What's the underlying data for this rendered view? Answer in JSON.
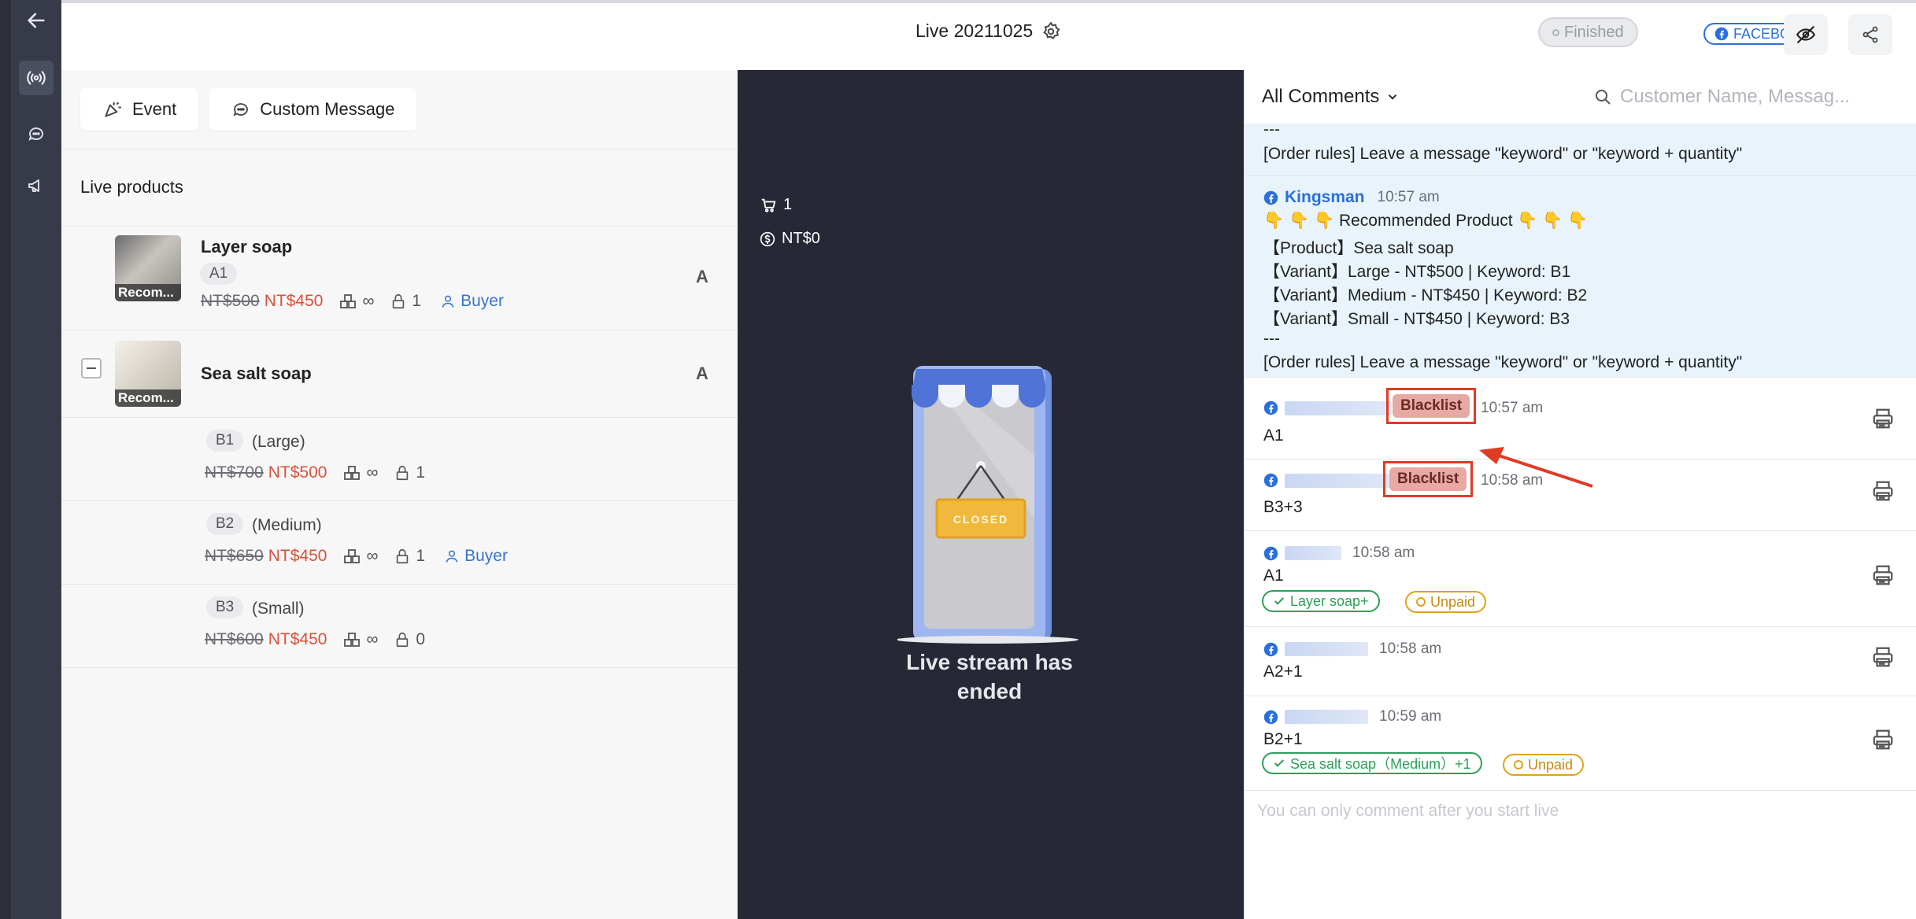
{
  "header": {
    "title": "Live 20211025",
    "status": "Finished",
    "platform": "FACEBOOK"
  },
  "left": {
    "tabs": [
      {
        "label": "Event"
      },
      {
        "label": "Custom Message"
      }
    ],
    "section_title": "Live products",
    "products": [
      {
        "name": "Layer soap",
        "thumb_caption": "Recom...",
        "code": "A1",
        "old_price": "NT$500",
        "new_price": "NT$450",
        "stock": "∞",
        "locked": "1",
        "buyer": "Buyer",
        "group": "A"
      },
      {
        "name": "Sea salt soap",
        "thumb_caption": "Recom...",
        "group": "A",
        "variants": [
          {
            "code": "B1",
            "label": "(Large)",
            "old_price": "NT$700",
            "new_price": "NT$500",
            "stock": "∞",
            "locked": "1",
            "buyer": ""
          },
          {
            "code": "B2",
            "label": "(Medium)",
            "old_price": "NT$650",
            "new_price": "NT$450",
            "stock": "∞",
            "locked": "1",
            "buyer": "Buyer"
          },
          {
            "code": "B3",
            "label": "(Small)",
            "old_price": "NT$600",
            "new_price": "NT$450",
            "stock": "∞",
            "locked": "0",
            "buyer": ""
          }
        ]
      }
    ]
  },
  "video": {
    "cart_count": "1",
    "revenue": "NT$0",
    "sign_text": "CLOSED",
    "ended_text": "Live stream has ended"
  },
  "comments": {
    "filter_label": "All Comments",
    "search_placeholder": "Customer Name, Messag...",
    "top_lines": [
      "---",
      "[Order rules] Leave a message \"keyword\" or \"keyword + quantity\""
    ],
    "host": {
      "name": "Kingsman",
      "time": "10:57 am",
      "lines": [
        "👇 👇 👇 Recommended Product 👇 👇 👇",
        "【Product】Sea salt soap",
        "【Variant】Large - NT$500 | Keyword: B1",
        "【Variant】Medium - NT$450 | Keyword: B2",
        "【Variant】Small - NT$450 | Keyword: B3",
        "---",
        "[Order rules] Leave a message \"keyword\" or \"keyword + quantity\""
      ]
    },
    "items": [
      {
        "badge": "Blacklist",
        "time": "10:57 am",
        "text": "A1"
      },
      {
        "badge": "Blacklist",
        "time": "10:58 am",
        "text": "B3+3"
      },
      {
        "time": "10:58 am",
        "text": "A1",
        "product_tag": "Layer soap+",
        "pay_status": "Unpaid"
      },
      {
        "time": "10:58 am",
        "text": "A2+1"
      },
      {
        "time": "10:59 am",
        "text": "B2+1",
        "product_tag": "Sea salt soap（Medium）+1",
        "pay_status": "Unpaid"
      }
    ],
    "footer": "You can only comment after you start live"
  },
  "colors": {
    "accent": "#2a6fdb",
    "price_red": "#d6533a",
    "highlight_red": "#e03b24",
    "paid_green": "#2e9e5b",
    "unpaid_orange": "#e0a21c"
  }
}
